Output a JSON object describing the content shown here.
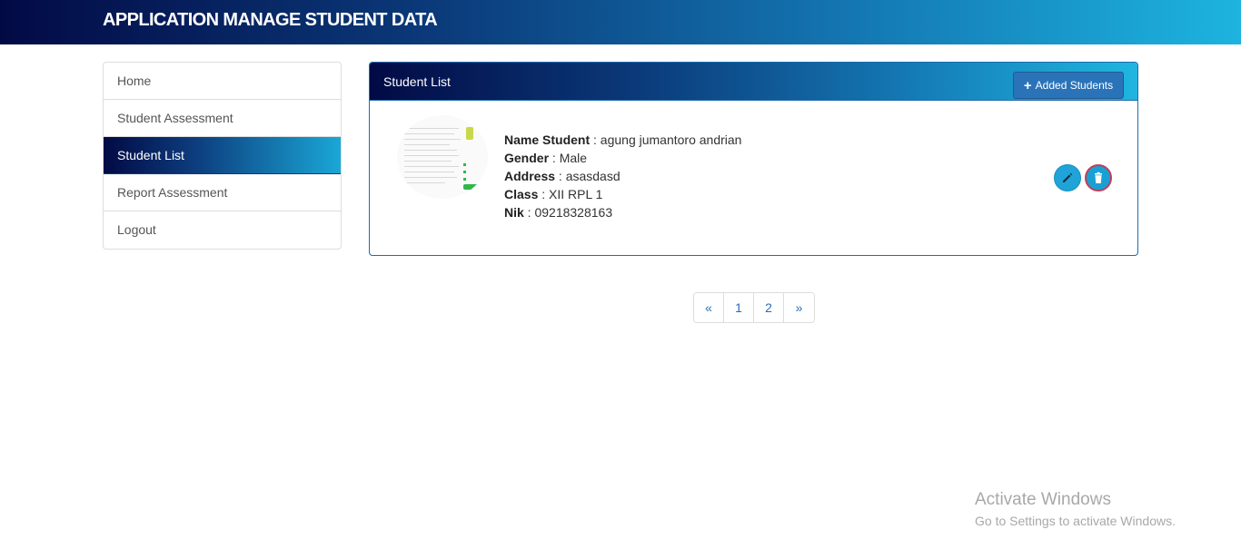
{
  "header": {
    "title": "APPLICATION MANAGE STUDENT DATA"
  },
  "sidebar": {
    "items": [
      {
        "label": "Home"
      },
      {
        "label": "Student Assessment"
      },
      {
        "label": "Student List",
        "active": true
      },
      {
        "label": "Report Assessment"
      },
      {
        "label": "Logout"
      }
    ]
  },
  "panel": {
    "title": "Student List",
    "add_button_label": "Added Students",
    "add_button_icon": "plus-icon"
  },
  "student": {
    "name_label": "Name Student",
    "name": "agung jumantoro andrian",
    "gender_label": "Gender",
    "gender": "Male",
    "address_label": "Address",
    "address": "asasdasd",
    "class_label": "Class",
    "class": "XII RPL 1",
    "nik_label": "Nik",
    "nik": "09218328163",
    "edit_icon": "pencil-icon",
    "delete_icon": "trash-icon"
  },
  "pagination": {
    "prev": "«",
    "pages": [
      "1",
      "2"
    ],
    "next": "»"
  },
  "watermark": {
    "title": "Activate Windows",
    "subtitle": "Go to Settings to activate Windows."
  },
  "colors": {
    "header_gradient_start": "#020a45",
    "header_gradient_end": "#1db4df",
    "button_blue": "#2a73b8",
    "circle_button": "#20a3d8",
    "delete_border": "#c0405a",
    "link_blue": "#2a6db5"
  }
}
